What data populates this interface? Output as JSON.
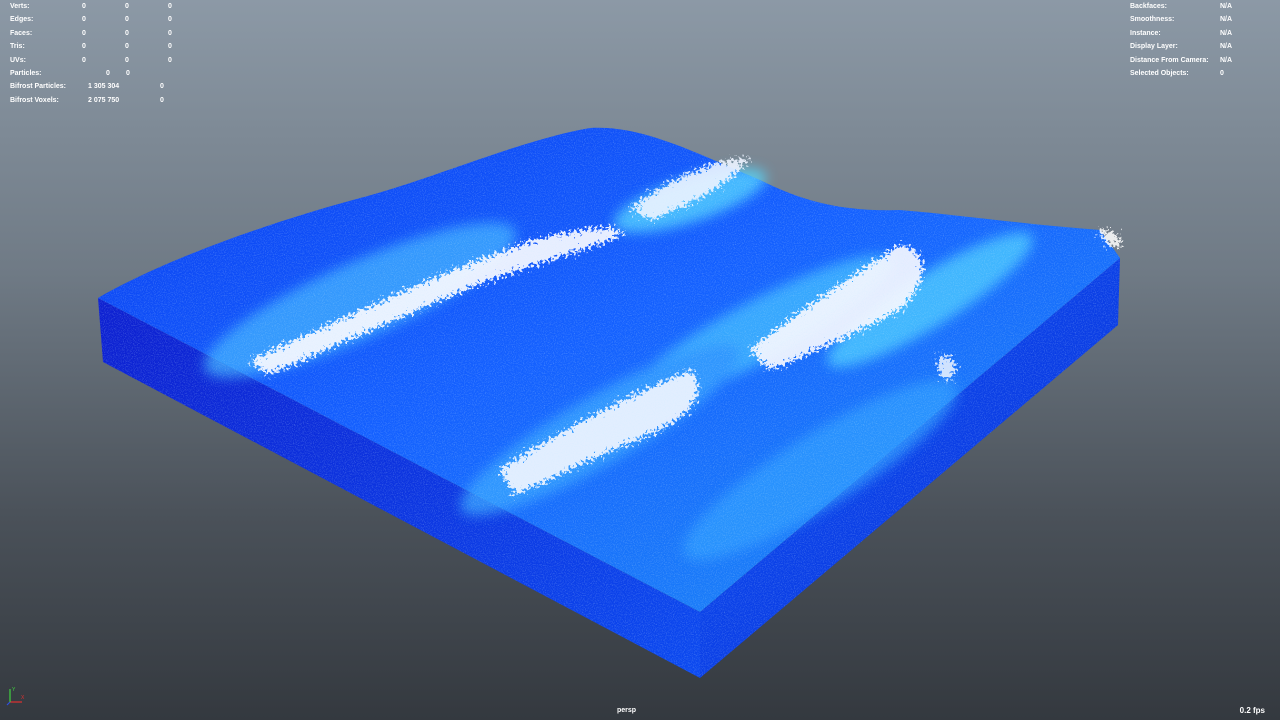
{
  "hud_left": {
    "rows": [
      {
        "label": "Verts:",
        "v1": "0",
        "v2": "0",
        "v3": "0"
      },
      {
        "label": "Edges:",
        "v1": "0",
        "v2": "0",
        "v3": "0"
      },
      {
        "label": "Faces:",
        "v1": "0",
        "v2": "0",
        "v3": "0"
      },
      {
        "label": "Tris:",
        "v1": "0",
        "v2": "0",
        "v3": "0"
      },
      {
        "label": "UVs:",
        "v1": "0",
        "v2": "0",
        "v3": "0"
      },
      {
        "label": "Particles:",
        "v1": "",
        "v2": "0",
        "v3": "0"
      },
      {
        "label": "Bifrost Particles:",
        "v1": "1 305 304",
        "v2": "",
        "v3": "0"
      },
      {
        "label": "Bifrost Voxels:",
        "v1": "2 075 750",
        "v2": "",
        "v3": "0"
      }
    ]
  },
  "hud_right": {
    "rows": [
      {
        "label": "Backfaces:",
        "value": "N/A"
      },
      {
        "label": "Smoothness:",
        "value": "N/A"
      },
      {
        "label": "Instance:",
        "value": "N/A"
      },
      {
        "label": "Display Layer:",
        "value": "N/A"
      },
      {
        "label": "Distance From Camera:",
        "value": "N/A"
      },
      {
        "label": "Selected Objects:",
        "value": "0"
      }
    ]
  },
  "viewport": {
    "camera_name": "persp",
    "fps": "0.2 fps",
    "colors": {
      "water_deep": "#0a2fe6",
      "water_mid": "#1a6bff",
      "water_light": "#3fb8ff",
      "foam": "#f2f6ff",
      "side_dark": "#0c22c4"
    }
  },
  "axis_gizmo": {
    "x_label": "X",
    "y_label": "Y",
    "x_color": "#e03030",
    "y_color": "#40d040"
  }
}
